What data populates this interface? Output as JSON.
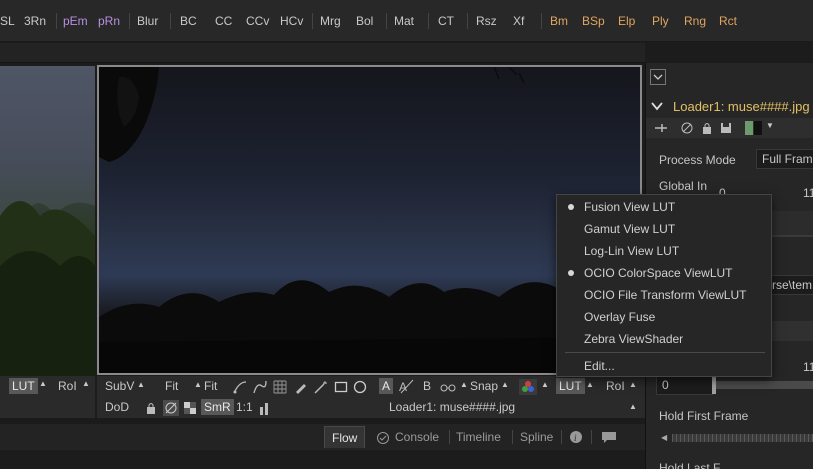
{
  "toolbar": {
    "items": [
      {
        "label": "SL"
      },
      {
        "label": "3Rn"
      },
      {
        "label": "pEm"
      },
      {
        "label": "pRn"
      },
      {
        "label": "Blur"
      },
      {
        "label": "BC"
      },
      {
        "label": "CC"
      },
      {
        "label": "CCv"
      },
      {
        "label": "HCv"
      },
      {
        "label": "Mrg"
      },
      {
        "label": "Bol"
      },
      {
        "label": "Mat"
      },
      {
        "label": "CT"
      },
      {
        "label": "Rsz"
      },
      {
        "label": "Xf"
      },
      {
        "label": "Bm"
      },
      {
        "label": "BSp"
      },
      {
        "label": "Elp"
      },
      {
        "label": "Ply"
      },
      {
        "label": "Rng"
      },
      {
        "label": "Rct"
      }
    ]
  },
  "viewer_left": {
    "lut": "LUT",
    "roi": "RoI"
  },
  "viewer_right": {
    "subv": "SubV",
    "fit1": "Fit",
    "fit2": "Fit",
    "a_label": "A",
    "b_label": "B",
    "snap": "Snap",
    "lut": "LUT",
    "roi": "RoI",
    "dod": "DoD",
    "smr": "SmR",
    "ratio": "1:1",
    "filename": "Loader1: muse####.jpg"
  },
  "inspector": {
    "title": "Loader1: muse####.jpg",
    "process_mode_label": "Process Mode",
    "process_mode_value": "Full Fram",
    "global_in_label": "Global In",
    "global_in_value_left": "0",
    "global_in_value_right": "11",
    "path_fragment": "rse\\tem",
    "slider_value_left": "0",
    "slider_value_right": "11",
    "hold_first_frame_label": "Hold First Frame",
    "hold_last_frame_label": "Hold Last F"
  },
  "lut_menu": {
    "items": [
      {
        "label": "Fusion View LUT",
        "checked": true
      },
      {
        "label": "Gamut View LUT",
        "checked": false
      },
      {
        "label": "Log-Lin View LUT",
        "checked": false
      },
      {
        "label": "OCIO ColorSpace ViewLUT",
        "checked": true
      },
      {
        "label": "OCIO File Transform ViewLUT",
        "checked": false
      },
      {
        "label": "Overlay Fuse",
        "checked": false
      },
      {
        "label": "Zebra ViewShader",
        "checked": false
      }
    ],
    "edit": "Edit..."
  },
  "bottom_tabs": {
    "flow": "Flow",
    "console": "Console",
    "timeline": "Timeline",
    "spline": "Spline"
  },
  "colors": {
    "accent_title": "#e2c064",
    "purple_tool": "#b98fe0",
    "orange_tool": "#e0a560",
    "menu_bg": "#262626"
  }
}
